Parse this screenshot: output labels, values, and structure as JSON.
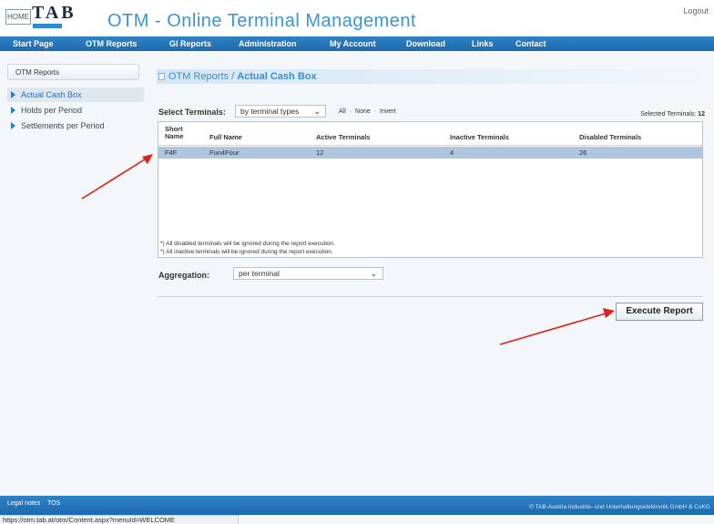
{
  "header": {
    "home_label": "HOME",
    "logo_text": "TAB",
    "app_title": "OTM - Online Terminal Management",
    "logout_label": "Logout"
  },
  "nav": {
    "items": [
      "Start Page",
      "OTM Reports",
      "GI Reports",
      "Administration",
      "My Account",
      "Download",
      "Links",
      "Contact"
    ]
  },
  "sidebar": {
    "title": "OTM Reports",
    "items": [
      {
        "label": "Actual Cash Box",
        "active": true
      },
      {
        "label": "Holds per Period",
        "active": false
      },
      {
        "label": "Settlements per Period",
        "active": false
      }
    ]
  },
  "breadcrumb": {
    "section": "OTM Reports",
    "separator": " / ",
    "current": "Actual Cash Box"
  },
  "select_terminals": {
    "label": "Select Terminals:",
    "dropdown_value": "by terminal types",
    "links": [
      "All",
      "None",
      "Invert"
    ],
    "link_separator": "·",
    "selected_label": "Selected Terminals:",
    "selected_count": "12"
  },
  "table": {
    "headers": {
      "short_name_1": "Short",
      "short_name_2": "Name",
      "full_name": "Full Name",
      "active": "Active Terminals",
      "inactive": "Inactive Terminals",
      "disabled": "Disabled Terminals"
    },
    "rows": [
      {
        "short_name": "F4F",
        "full_name": "Fun4Four",
        "active": "12",
        "inactive": "4",
        "disabled": "26"
      }
    ]
  },
  "notes": [
    "*) All disabled terminals will be ignored during the report execution.",
    "*) All inactive terminals will be ignored during the report execution."
  ],
  "aggregation": {
    "label": "Aggregation:",
    "value": "per terminal"
  },
  "execute_button_label": "Execute Report",
  "footer": {
    "legal": "Legal notes",
    "tos": "TOS",
    "copyright": "© TAB-Austria Industrie- und Unterhaltungselektronik GmbH & CoKG"
  },
  "status_url": "https://otm.tab.at/otm/Content.aspx?menuId=WELCOME",
  "colors": {
    "nav_blue": "#1d69ad",
    "title_blue": "#3c95cf",
    "row_selected": "#aec6dd",
    "arrow_red": "#e0201b"
  }
}
